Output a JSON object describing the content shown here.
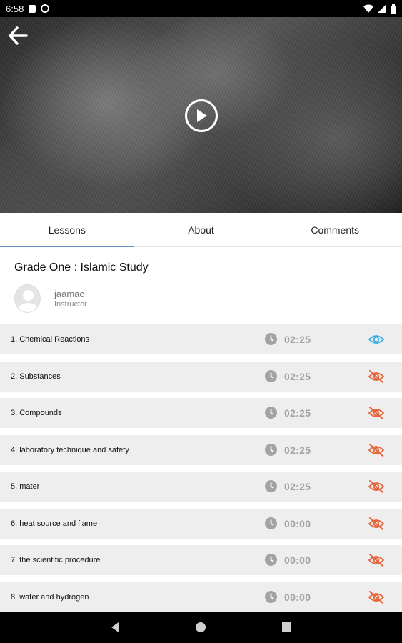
{
  "status_bar": {
    "time": "6:58"
  },
  "tabs": [
    {
      "label": "Lessons",
      "active": true
    },
    {
      "label": "About",
      "active": false
    },
    {
      "label": "Comments",
      "active": false
    }
  ],
  "course": {
    "title": "Grade One : Islamic Study",
    "instructor_name": "jaamac",
    "instructor_role": "Instructor"
  },
  "lessons": [
    {
      "title": "1. Chemical Reactions",
      "duration": "02:25",
      "visibility": "visible"
    },
    {
      "title": "2. Substances",
      "duration": "02:25",
      "visibility": "hidden"
    },
    {
      "title": "3. Compounds",
      "duration": "02:25",
      "visibility": "hidden"
    },
    {
      "title": "4. laboratory technique and safety",
      "duration": "02:25",
      "visibility": "hidden"
    },
    {
      "title": "5. mater",
      "duration": "02:25",
      "visibility": "hidden"
    },
    {
      "title": "6. heat source and flame",
      "duration": "00:00",
      "visibility": "hidden"
    },
    {
      "title": "7. the scientific procedure",
      "duration": "00:00",
      "visibility": "hidden"
    },
    {
      "title": "8. water and hydrogen",
      "duration": "00:00",
      "visibility": "hidden"
    }
  ],
  "colors": {
    "tab_indicator": "#6a8fc0",
    "eye_visible": "#3aaee0",
    "eye_hidden": "#e5643a",
    "duration_text": "#a3a3a3",
    "row_background": "#eeeeee"
  },
  "icons": {
    "back": "arrow-left-icon",
    "play": "play-circle-icon",
    "clock": "clock-icon",
    "eye_visible": "eye-icon",
    "eye_hidden": "eye-off-icon"
  }
}
